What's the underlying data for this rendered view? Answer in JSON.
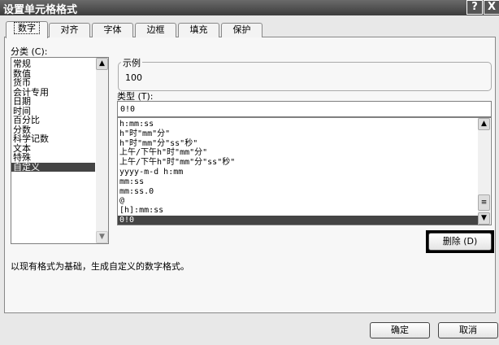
{
  "title": "设置单元格格式",
  "title_buttons": {
    "help": "?",
    "close": "X"
  },
  "tabs": [
    "数字",
    "对齐",
    "字体",
    "边框",
    "填充",
    "保护"
  ],
  "category": {
    "label": "分类 (C):",
    "items": [
      "常规",
      "数值",
      "货币",
      "会计专用",
      "日期",
      "时间",
      "百分比",
      "分数",
      "科学记数",
      "文本",
      "特殊",
      "自定义"
    ],
    "selected": "自定义"
  },
  "sample": {
    "label": "示例",
    "value": "100"
  },
  "type": {
    "label": "类型 (T):",
    "value": "0!0",
    "items": [
      "h:mm:ss",
      "h\"时\"mm\"分\"",
      "h\"时\"mm\"分\"ss\"秒\"",
      "上午/下午h\"时\"mm\"分\"",
      "上午/下午h\"时\"mm\"分\"ss\"秒\"",
      "yyyy-m-d h:mm",
      "mm:ss",
      "mm:ss.0",
      "@",
      "[h]:mm:ss",
      "0!0"
    ],
    "selected": "0!0"
  },
  "delete_label": "删除 (D)",
  "description": "以现有格式为基础，生成自定义的数字格式。",
  "ok_label": "确定",
  "cancel_label": "取消"
}
